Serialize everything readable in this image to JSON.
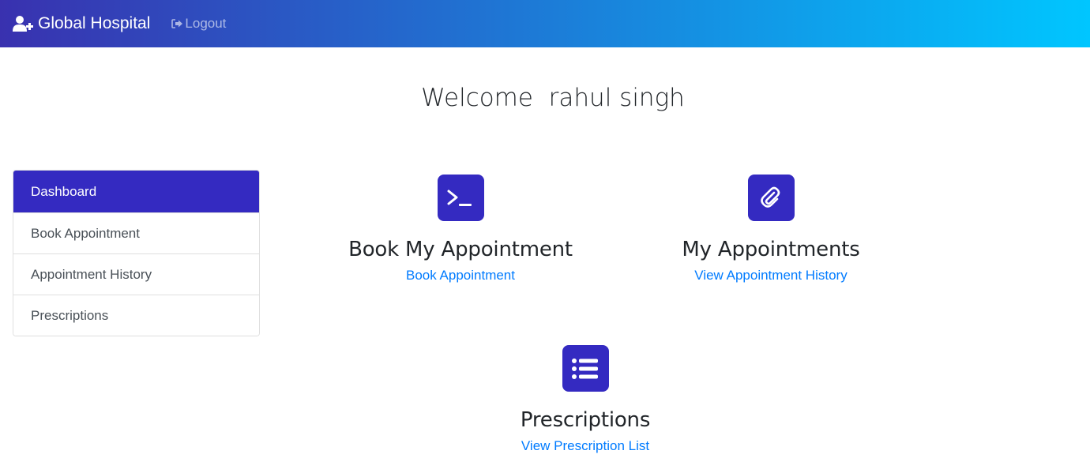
{
  "navbar": {
    "brand": "Global Hospital",
    "brand_icon": "user-plus-icon",
    "logout_label": "Logout",
    "logout_icon": "sign-out-icon",
    "gradient_start": "#3931af",
    "gradient_end": "#00c6ff"
  },
  "welcome": {
    "text": "Welcome  rahul singh"
  },
  "sidebar": {
    "items": [
      {
        "label": "Dashboard",
        "active": true
      },
      {
        "label": "Book Appointment",
        "active": false
      },
      {
        "label": "Appointment History",
        "active": false
      },
      {
        "label": "Prescriptions",
        "active": false
      }
    ],
    "active_color": "#342ac1"
  },
  "cards": [
    {
      "icon": "terminal-icon",
      "title": "Book My Appointment",
      "link": "Book Appointment"
    },
    {
      "icon": "paperclip-icon",
      "title": "My Appointments",
      "link": "View Appointment History"
    },
    {
      "icon": "list-icon",
      "title": "Prescriptions",
      "link": "View Prescription List"
    }
  ],
  "colors": {
    "accent": "#342ac1",
    "link": "#007bff"
  }
}
